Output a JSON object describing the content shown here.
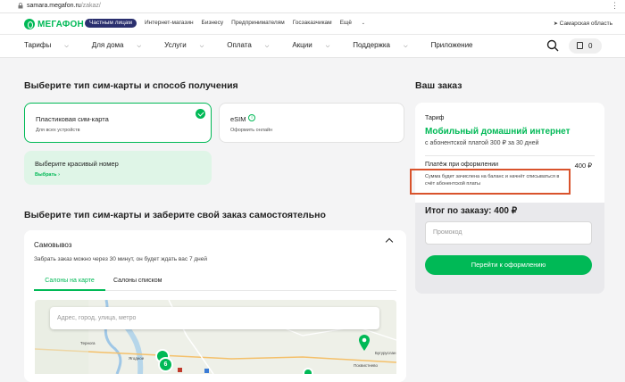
{
  "browser": {
    "url_host": "samara.megafon.ru",
    "url_path": "/zakaz/"
  },
  "top_strip": {
    "logo": "МЕГАФОН",
    "links": [
      "Частным лицам",
      "Интернет-магазин",
      "Бизнесу",
      "Предпринимателям",
      "Госзаказчикам",
      "Ещё"
    ],
    "active_link": "Частным лицам",
    "region": "Самарская область"
  },
  "main_nav": {
    "items": [
      "Тарифы",
      "Для дома",
      "Услуги",
      "Оплата",
      "Акции",
      "Поддержка",
      "Приложение"
    ],
    "cart_count": "0"
  },
  "sim_section": {
    "heading": "Выберите тип сим-карты и способ получения",
    "plastic": {
      "title": "Пластиковая сим-карта",
      "subtitle": "Для всех устройств",
      "selected": true
    },
    "esim": {
      "title": "eSIM",
      "info_icon": "i",
      "subtitle": "Оформить онлайн"
    },
    "beautiful_number": {
      "title": "Выберите красивый номер",
      "link": "Выбрать ›"
    }
  },
  "pickup_section": {
    "heading": "Выберите тип сим-карты и заберите свой заказ самостоятельно",
    "title": "Самовывоз",
    "description": "Забрать заказ можно через 30 минут, он будет ждать вас 7 дней",
    "tabs": [
      "Салоны на карте",
      "Салоны списком"
    ],
    "active_tab": "Салоны на карте",
    "map_search_placeholder": "Адрес, город, улица, метро",
    "map_labels": [
      "Тернога",
      "Ягодное",
      "Похвистнево",
      "Бугуруслан"
    ],
    "map_cluster_counts": [
      "6"
    ]
  },
  "order": {
    "heading": "Ваш заказ",
    "tariff_label": "Тариф",
    "tariff_name": "Мобильный домашний интернет",
    "tariff_desc": "с абонентской платой 300 ₽ за 30 дней",
    "payment_label": "Платёж при оформлении",
    "payment_value": "400 ₽",
    "note": "Сумма будет зачислена на баланс и начнёт списываться в счёт абонентской платы",
    "total": "Итог по заказу: 400 ₽",
    "promo_placeholder": "Промокод",
    "checkout_label": "Перейти к оформлению"
  },
  "colors": {
    "brand_green": "#00b956",
    "accent_purple": "#2a2f6e",
    "highlight_red": "#d9532c"
  }
}
